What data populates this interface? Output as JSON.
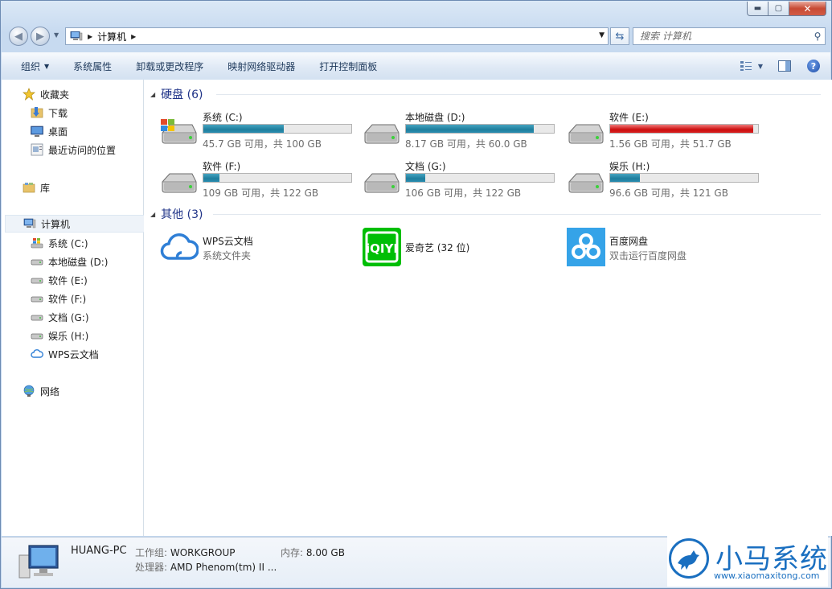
{
  "window": {
    "caption_buttons": {
      "minimize": "▬",
      "maximize": "▢",
      "close": "✕"
    }
  },
  "navigation": {
    "address_segments": [
      "计算机"
    ],
    "search_placeholder": "搜索 计算机"
  },
  "command_bar": {
    "organize": "组织",
    "system_properties": "系统属性",
    "uninstall": "卸载或更改程序",
    "map_drive": "映射网络驱动器",
    "control_panel": "打开控制面板"
  },
  "sidebar": {
    "favorites": {
      "label": "收藏夹",
      "items": [
        "下载",
        "桌面",
        "最近访问的位置"
      ]
    },
    "libraries": {
      "label": "库"
    },
    "computer": {
      "label": "计算机",
      "items": [
        "系统 (C:)",
        "本地磁盘 (D:)",
        "软件 (E:)",
        "软件 (F:)",
        "文档 (G:)",
        "娱乐 (H:)",
        "WPS云文档"
      ]
    },
    "network": {
      "label": "网络"
    }
  },
  "content": {
    "drives_header": "硬盘 (6)",
    "drives": [
      {
        "name": "系统 (C:)",
        "free": "45.7 GB 可用，共 100 GB",
        "used_fraction": 0.543,
        "full": false
      },
      {
        "name": "本地磁盘 (D:)",
        "free": "8.17 GB 可用，共 60.0 GB",
        "used_fraction": 0.864,
        "full": false
      },
      {
        "name": "软件 (E:)",
        "free": "1.56 GB 可用，共 51.7 GB",
        "used_fraction": 0.97,
        "full": true
      },
      {
        "name": "软件 (F:)",
        "free": "109 GB 可用，共 122 GB",
        "used_fraction": 0.107,
        "full": false
      },
      {
        "name": "文档 (G:)",
        "free": "106 GB 可用，共 122 GB",
        "used_fraction": 0.131,
        "full": false
      },
      {
        "name": "娱乐 (H:)",
        "free": "96.6 GB 可用，共 121 GB",
        "used_fraction": 0.202,
        "full": false
      }
    ],
    "other_header": "其他 (3)",
    "other": [
      {
        "name": "WPS云文档",
        "sub": "系统文件夹",
        "icon": "cloud-icon"
      },
      {
        "name": "爱奇艺 (32 位)",
        "sub": "",
        "icon": "iqiyi-icon"
      },
      {
        "name": "百度网盘",
        "sub": "双击运行百度网盘",
        "icon": "baidu-netdisk-icon"
      }
    ]
  },
  "details": {
    "computer_name": "HUANG-PC",
    "workgroup_label": "工作组:",
    "workgroup_value": "WORKGROUP",
    "memory_label": "内存:",
    "memory_value": "8.00 GB",
    "processor_label": "处理器:",
    "processor_value": "AMD Phenom(tm) II ..."
  },
  "watermark": {
    "brand": "小马系统",
    "url": "www.xiaomaxitong.com"
  },
  "colors": {
    "bar_normal": "#26839f",
    "bar_full": "#cc0e0e",
    "group_header": "#1e3287",
    "brand": "#1a6fc0"
  }
}
